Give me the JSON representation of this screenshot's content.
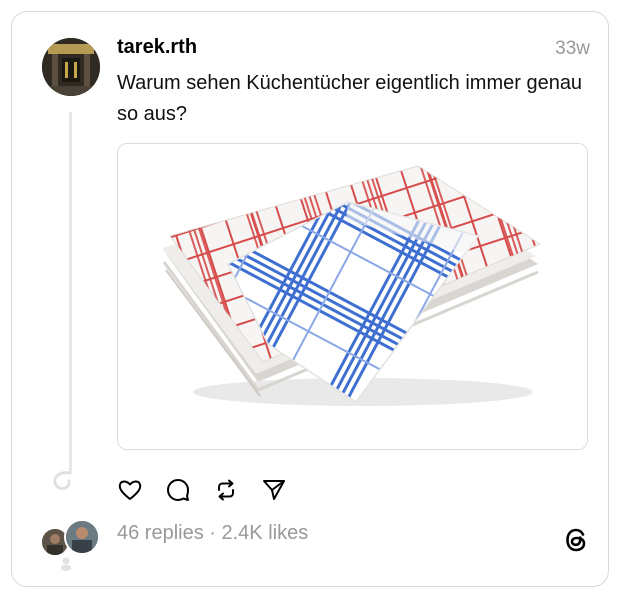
{
  "post": {
    "username": "tarek.rth",
    "timestamp": "33w",
    "text": "Warum sehen Küchentücher eigentlich immer genau so aus?"
  },
  "media": {
    "description_icon": "kitchen-towels-photo"
  },
  "actions": {
    "like_icon": "heart-icon",
    "reply_icon": "comment-icon",
    "repost_icon": "repost-icon",
    "share_icon": "send-icon"
  },
  "stats": {
    "text": "46 replies · 2.4K likes"
  },
  "brand": {
    "logo": "threads-logo"
  },
  "colors": {
    "muted": "#999999",
    "border": "#d9d9d9",
    "towel_red": "#d64b4b",
    "towel_blue": "#3f6fd0"
  }
}
